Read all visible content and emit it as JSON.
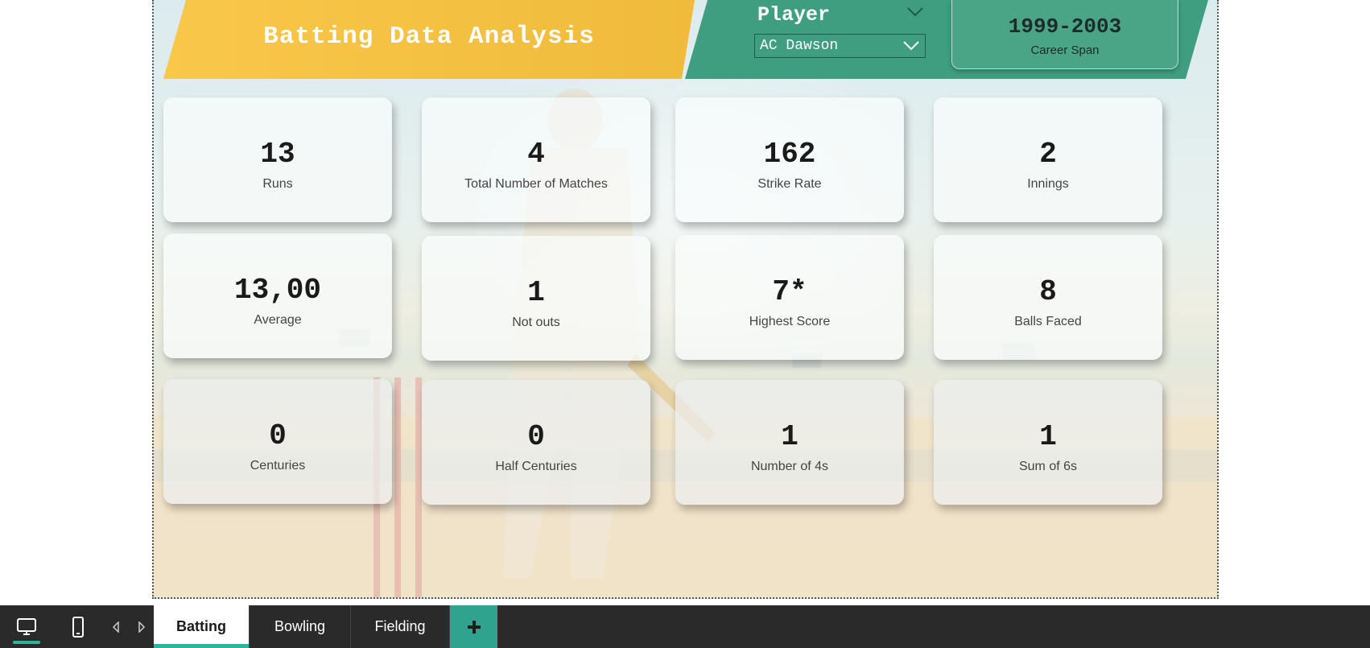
{
  "header": {
    "title": "Batting Data Analysis",
    "player_label": "Player",
    "player_value": "AC Dawson",
    "career_span_value": "1999-2003",
    "career_span_label": "Career Span"
  },
  "kpis": [
    {
      "value": "13",
      "label": "Runs"
    },
    {
      "value": "4",
      "label": "Total Number of Matches"
    },
    {
      "value": "162",
      "label": "Strike Rate"
    },
    {
      "value": "2",
      "label": "Innings"
    },
    {
      "value": "13,00",
      "label": "Average"
    },
    {
      "value": "1",
      "label": "Not outs"
    },
    {
      "value": "7*",
      "label": "Highest Score"
    },
    {
      "value": "8",
      "label": "Balls Faced"
    },
    {
      "value": "0",
      "label": "Centuries"
    },
    {
      "value": "0",
      "label": "Half Centuries"
    },
    {
      "value": "1",
      "label": "Number of 4s"
    },
    {
      "value": "1",
      "label": "Sum of 6s"
    }
  ],
  "tabs": [
    {
      "label": "Batting",
      "active": true
    },
    {
      "label": "Bowling",
      "active": false
    },
    {
      "label": "Fielding",
      "active": false
    }
  ],
  "icons": {
    "desktop": "desktop-icon",
    "phone": "phone-icon",
    "prev": "chevron-left-icon",
    "next": "chevron-right-icon",
    "add": "plus-icon"
  },
  "colors": {
    "title_band": "#f9c74a",
    "header_green": "#3f9e80",
    "accent_teal": "#2fb39a",
    "bottom_bar": "#2a2a2a"
  }
}
